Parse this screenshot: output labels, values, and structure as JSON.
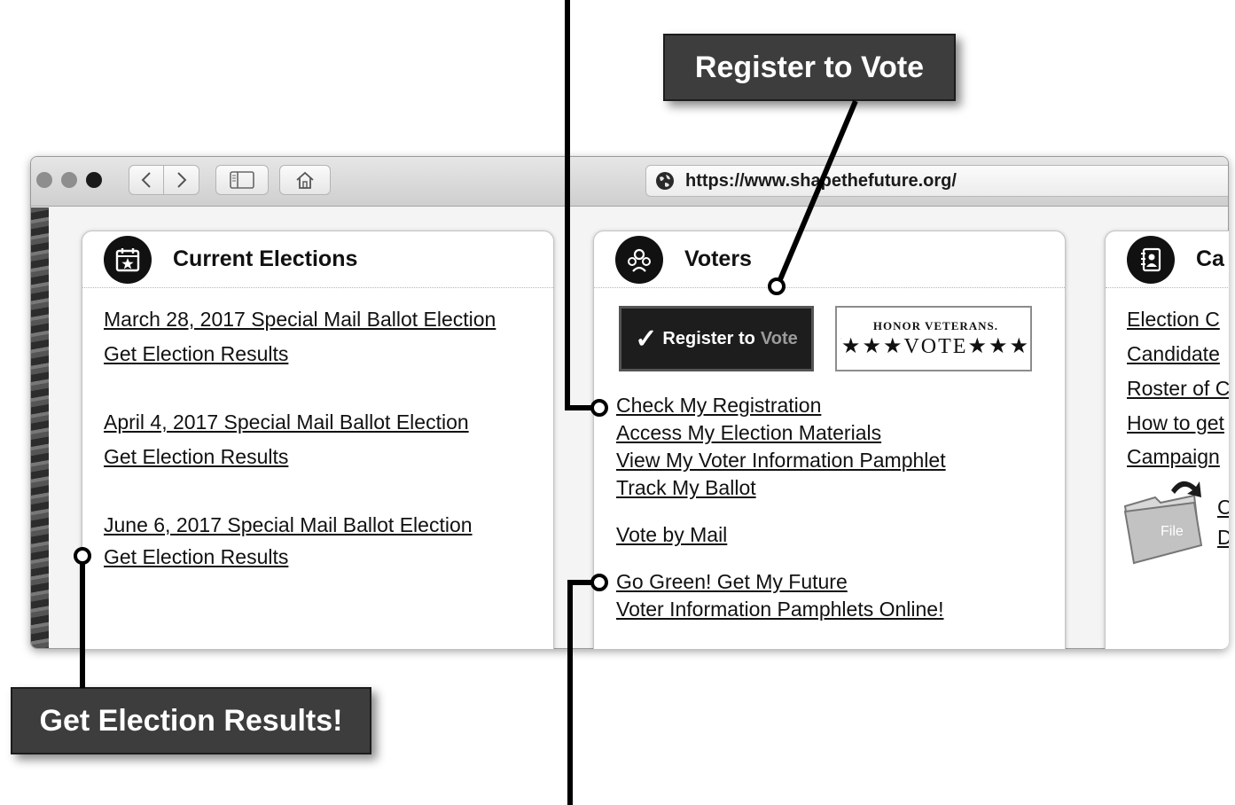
{
  "callouts": {
    "register": "Register to Vote",
    "results": "Get Election Results!"
  },
  "browser": {
    "url": "https://www.shapethefuture.org/",
    "back_icon": "chevron-left-icon",
    "forward_icon": "chevron-right-icon",
    "sidebar_icon": "sidebar-icon",
    "home_icon": "home-icon"
  },
  "elections": {
    "title": "Current Elections",
    "items": [
      {
        "name": "March 28, 2017 Special Mail Ballot Election",
        "results": "Get Election Results"
      },
      {
        "name": "April 4, 2017 Special Mail Ballot Election",
        "results": "Get Election Results"
      },
      {
        "name": "June 6, 2017 Special Mail Ballot Election",
        "results": "Get Election Results"
      }
    ]
  },
  "voters": {
    "title": "Voters",
    "register_banner": {
      "check": "✓",
      "text": "Register to",
      "vote": "Vote"
    },
    "veterans_banner": {
      "line1": "HONOR VETERANS.",
      "line2": "★★★VOTE★★★"
    },
    "links": [
      "Check My Registration",
      "Access My Election Materials",
      "View My Voter Information Pamphlet",
      "Track My Ballot",
      "Vote by Mail",
      "Go Green! Get My Future",
      "Voter Information Pamphlets Online!"
    ]
  },
  "candidates": {
    "title": "Ca",
    "links": [
      "Election C",
      "Candidate",
      "Roster of C",
      "How to get",
      "Campaign"
    ],
    "file_label": "File",
    "side_letters": [
      "C",
      "D"
    ]
  }
}
